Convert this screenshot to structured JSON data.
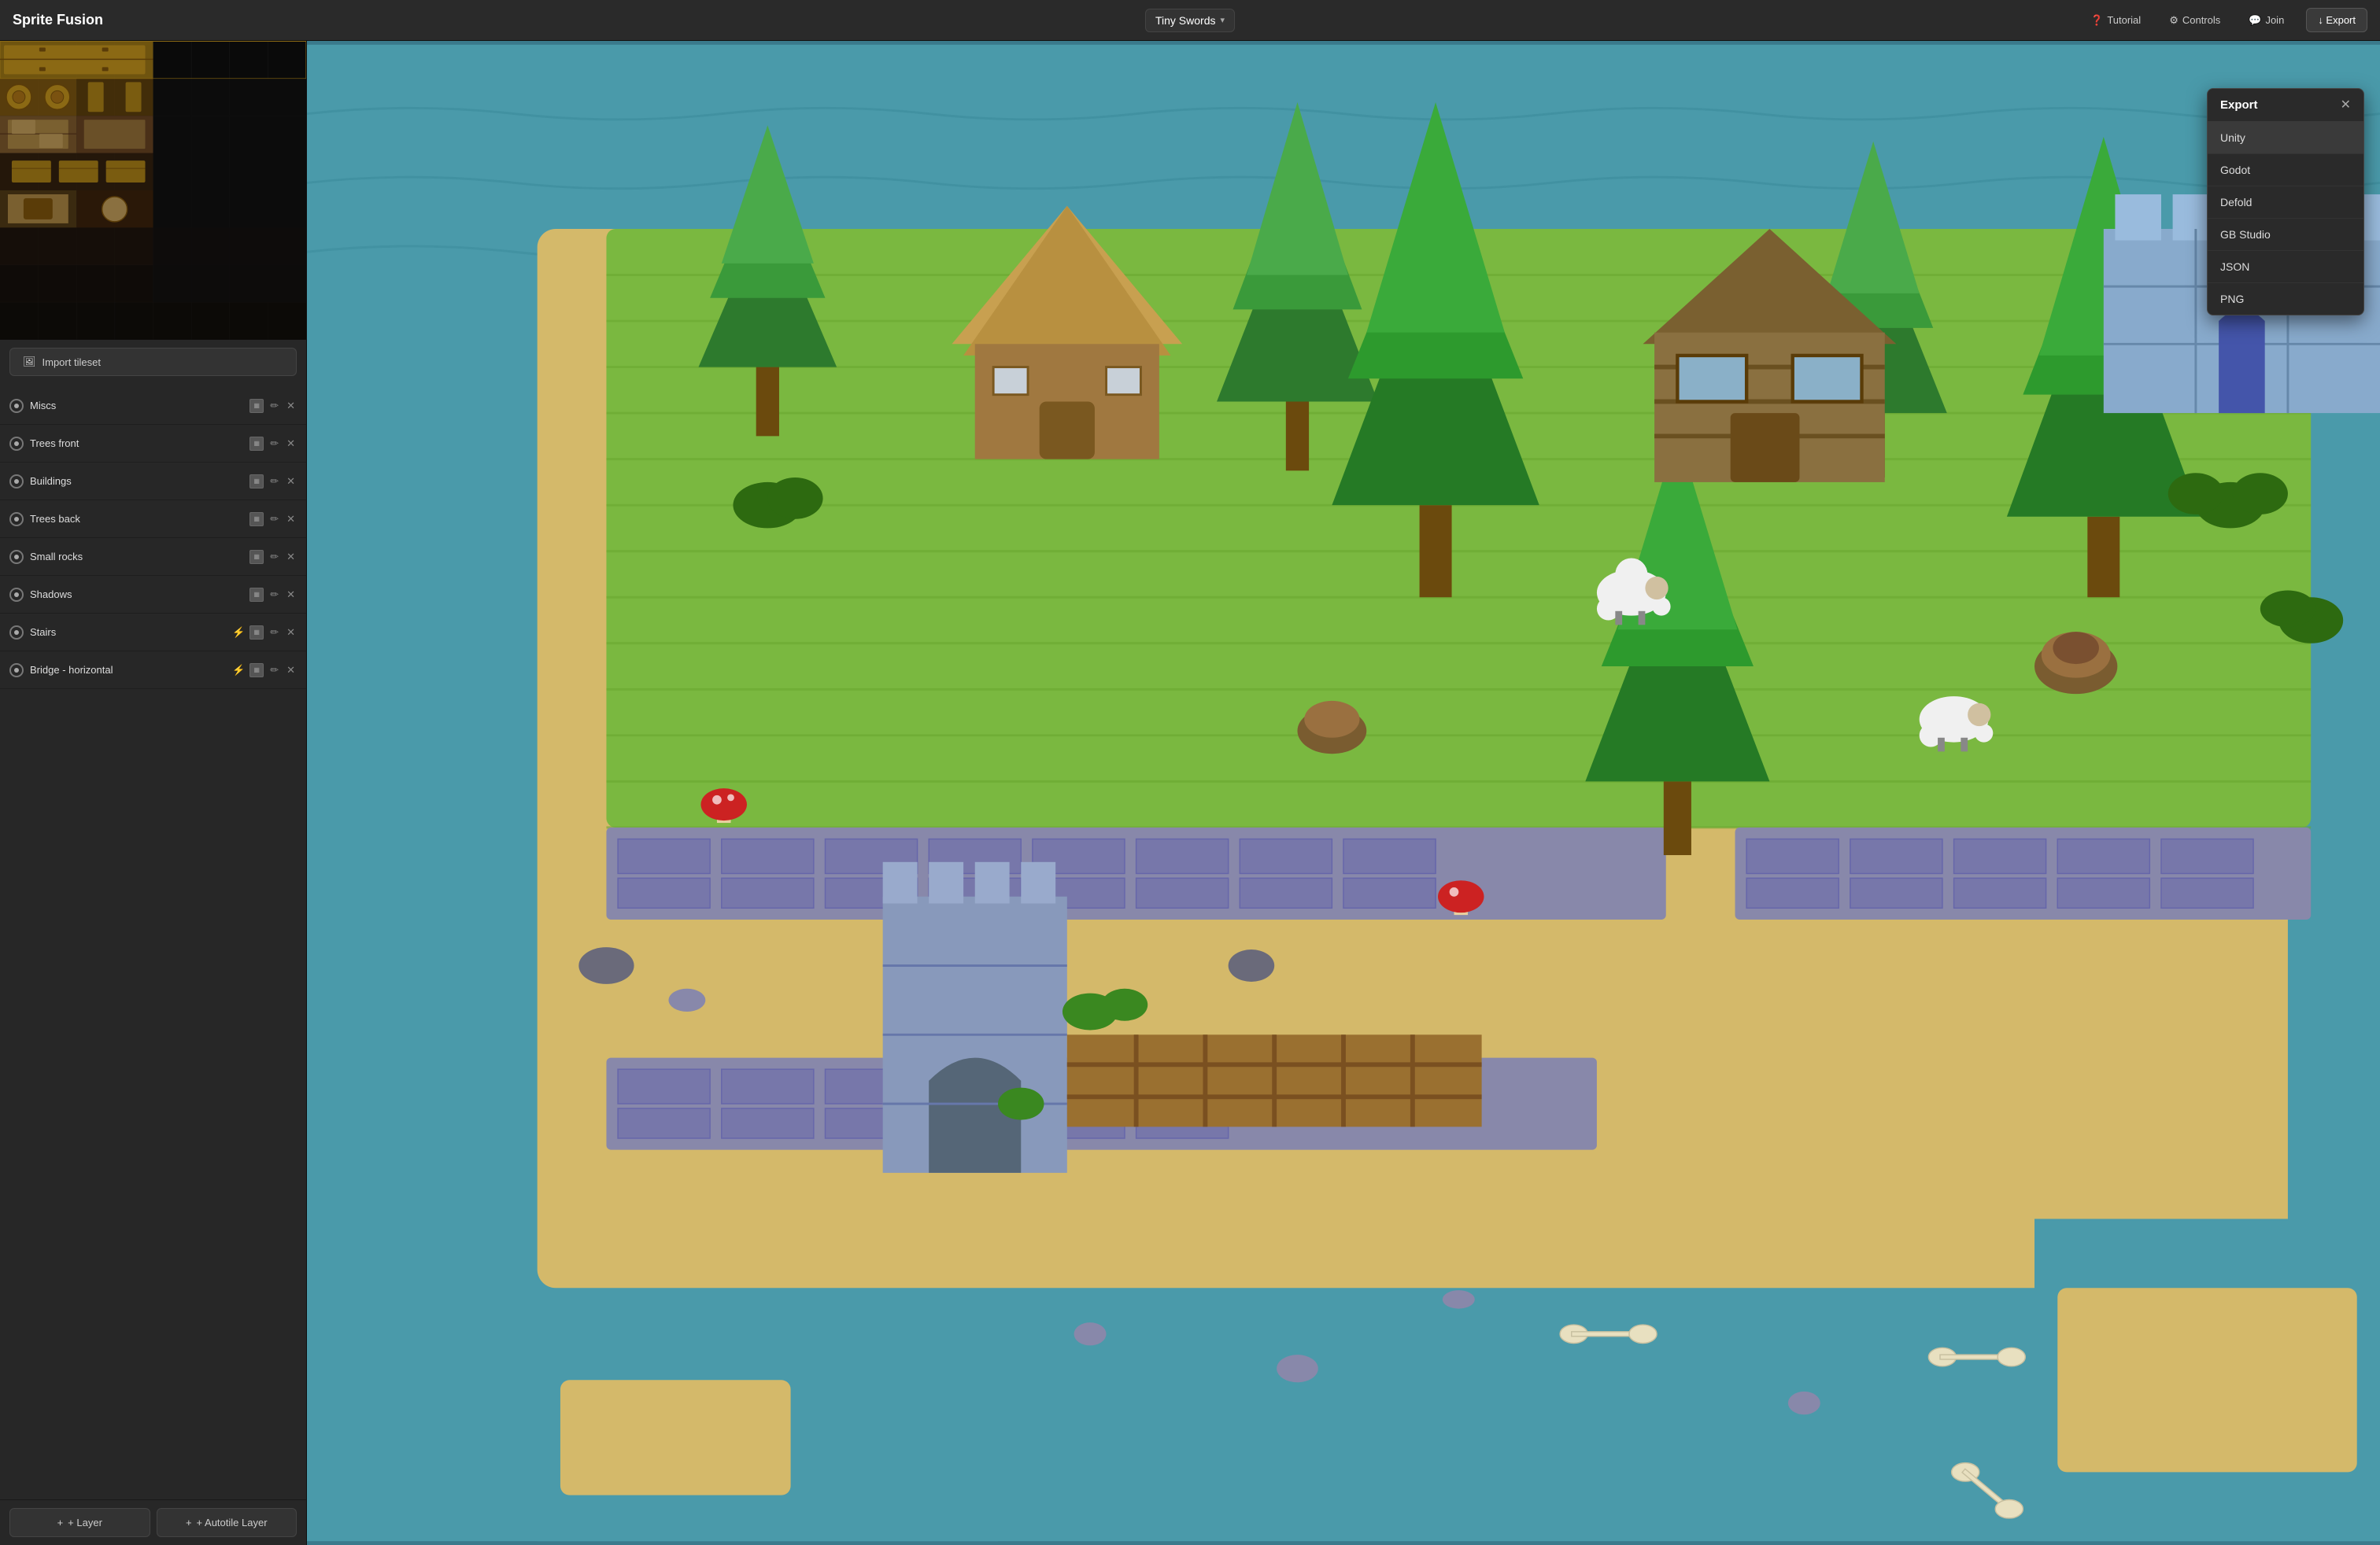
{
  "app": {
    "title": "Sprite Fusion"
  },
  "header": {
    "project_name": "Tiny Swords",
    "project_chevron": "▾",
    "tutorial_label": "Tutorial",
    "controls_label": "Controls",
    "join_label": "Join",
    "export_label": "↓ Export",
    "tutorial_icon": "❓",
    "controls_icon": "⚙",
    "join_icon": "💬"
  },
  "sidebar": {
    "import_btn_label": "Import tileset",
    "import_icon": "🖼"
  },
  "layers": [
    {
      "name": "Miscs",
      "eye": true,
      "thumb": true,
      "edit": true,
      "close": true,
      "lightning": false
    },
    {
      "name": "Trees front",
      "eye": true,
      "thumb": true,
      "edit": true,
      "close": true,
      "lightning": false
    },
    {
      "name": "Buildings",
      "eye": true,
      "thumb": true,
      "edit": true,
      "close": true,
      "lightning": false
    },
    {
      "name": "Trees back",
      "eye": true,
      "thumb": true,
      "edit": true,
      "close": true,
      "lightning": false
    },
    {
      "name": "Small rocks",
      "eye": true,
      "thumb": true,
      "edit": true,
      "close": true,
      "lightning": false
    },
    {
      "name": "Shadows",
      "eye": true,
      "thumb": true,
      "edit": true,
      "close": true,
      "lightning": false
    },
    {
      "name": "Stairs",
      "eye": true,
      "thumb": true,
      "edit": true,
      "close": true,
      "lightning": true
    },
    {
      "name": "Bridge - horizontal",
      "eye": true,
      "thumb": true,
      "edit": true,
      "close": true,
      "lightning": true
    }
  ],
  "add_layer": {
    "layer_label": "+ Layer",
    "autotile_label": "+ Autotile Layer"
  },
  "export_dropdown": {
    "title": "Export",
    "close_btn": "✕",
    "options": [
      {
        "label": "Unity",
        "active": true
      },
      {
        "label": "Godot",
        "active": false
      },
      {
        "label": "Defold",
        "active": false
      },
      {
        "label": "GB Studio",
        "active": false
      },
      {
        "label": "JSON",
        "active": false
      },
      {
        "label": "PNG",
        "active": false
      }
    ]
  },
  "colors": {
    "bg_dark": "#272727",
    "bg_mid": "#2a2a2a",
    "accent_yellow": "#f0c040",
    "map_water": "#4a9aaa",
    "map_grass": "#7ab840",
    "map_sand": "#d4b96a",
    "map_stone": "#8888aa",
    "export_active": "#3a3a3a"
  }
}
